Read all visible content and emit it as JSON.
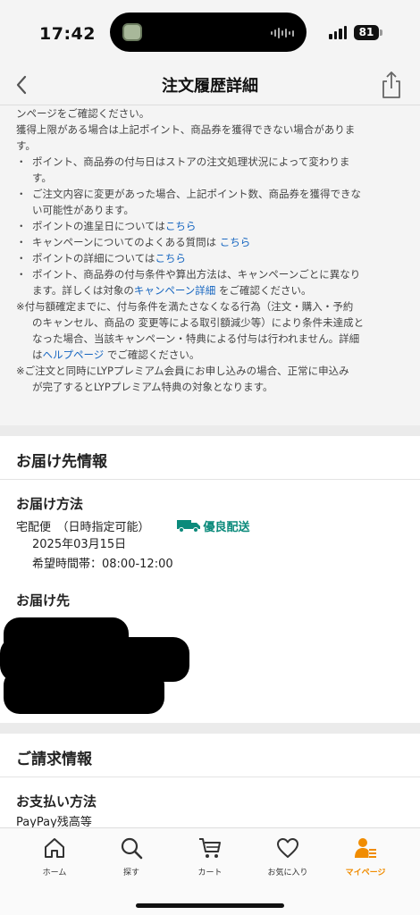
{
  "status": {
    "time": "17:42",
    "battery": "81"
  },
  "nav": {
    "title": "注文履歴詳細"
  },
  "notes": {
    "line0": "ンページをご確認ください。",
    "line1": "獲得上限がある場合は上記ポイント、商品券を獲得できない場合がありま",
    "line1b": "す。",
    "b1a": "ポイント、商品券の付与日はストアの注文処理状況によって変わりま",
    "b1b": "す。",
    "b2a": "ご注文内容に変更があった場合、上記ポイント数、商品券を獲得できな",
    "b2b": "い可能性があります。",
    "b3": "ポイントの進呈日については",
    "b3_link": "こちら",
    "b4": "キャンペーンについてのよくある質問は ",
    "b4_link": "こちら",
    "b5": "ポイントの詳細については",
    "b5_link": "こちら",
    "b6a": "ポイント、商品券の付与条件や算出方法は、キャンペーンごとに異なり",
    "b6b_pre": "ます。詳しくは対象の",
    "b6b_link": "キャンペーン詳細",
    "b6b_post": " をご確認ください。",
    "n1a": "※付与額確定までに、付与条件を満たさなくなる行為（注文・購入・予約",
    "n1b": "のキャンセル、商品の 変更等による取引額減少等）により条件未達成と",
    "n1c": "なった場合、当該キャンペーン・特典による付与は行われません。詳細",
    "n1d_pre": "は",
    "n1d_link": "ヘルプページ",
    "n1d_post": " でご確認ください。",
    "n2a": "※ご注文と同時にLYPプレミアム会員にお申し込みの場合、正常に申込み",
    "n2b": "が完了するとLYPプレミアム特典の対象となります。",
    "bullet": "・"
  },
  "delivery": {
    "section_title": "お届け先情報",
    "method_title": "お届け方法",
    "method": "宅配便　（日時指定可能）",
    "badge": "優良配送",
    "date": "2025年03月15日",
    "time_slot": "希望時間帯：08:00-12:00",
    "address_title": "お届け先"
  },
  "billing": {
    "section_title": "ご請求情報",
    "payment_title": "お支払い方法",
    "payment_value": "PayPay残高等"
  },
  "tabs": [
    {
      "label": "ホーム"
    },
    {
      "label": "探す"
    },
    {
      "label": "カート"
    },
    {
      "label": "お気に入り"
    },
    {
      "label": "マイページ"
    }
  ],
  "colors": {
    "accent": "#f08c00",
    "link": "#1565c0",
    "badge": "#0b8a7b"
  }
}
